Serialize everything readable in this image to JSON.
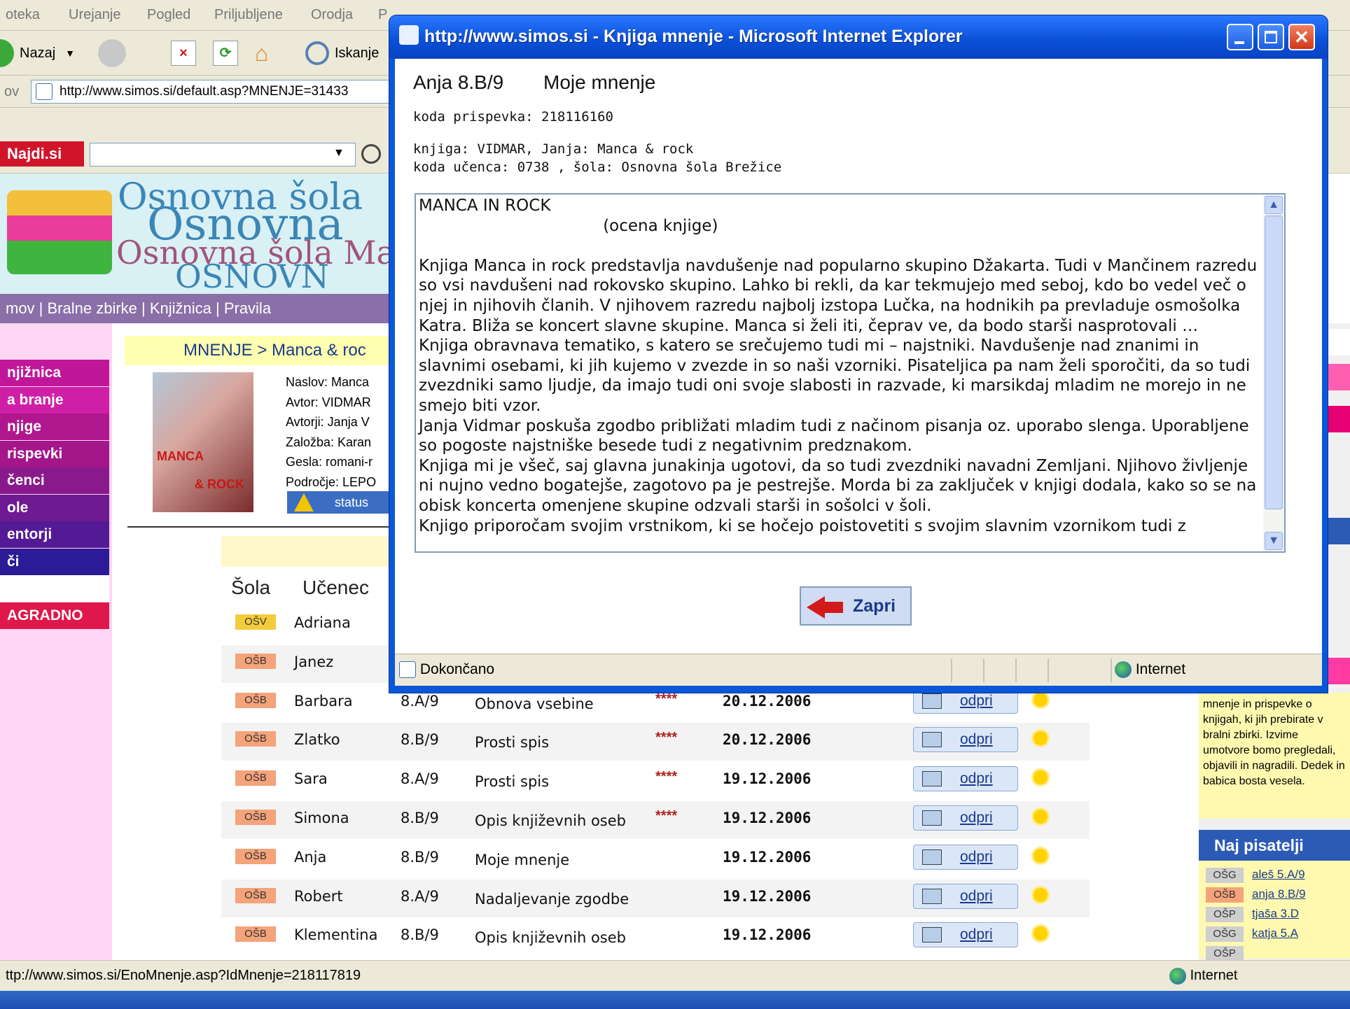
{
  "bg_menubar": [
    "oteka",
    "Urejanje",
    "Pogled",
    "Priljubljene",
    "Orodja",
    "P"
  ],
  "bg_toolbar": {
    "back_label": "Nazaj",
    "search_label": "Iskanje"
  },
  "bg_address": {
    "label": "ov",
    "url": "http://www.simos.si/default.asp?MNENJE=31433"
  },
  "najdi": {
    "logo": "Najdi.si"
  },
  "banner": {
    "line1": "Osnovna šola",
    "line2": "Osnovna",
    "line3": "Osnovna šola Maj",
    "line4": "OSNOVN"
  },
  "site_nav": "mov  |  Bralne zbirke  |  Knjižnica  |  Pravila",
  "side_menu": [
    {
      "label": "njižnica",
      "color": "#c0169a"
    },
    {
      "label": "a branje",
      "color": "#cf1fa7"
    },
    {
      "label": "njige",
      "color": "#b0168e"
    },
    {
      "label": "rispevki",
      "color": "#a4168a"
    },
    {
      "label": "čenci",
      "color": "#8a1a8c"
    },
    {
      "label": "ole",
      "color": "#6e1a92"
    },
    {
      "label": "entorji",
      "color": "#541a96"
    },
    {
      "label": "či",
      "color": "#2c1a96"
    },
    {
      "label": "",
      "color": "#ffffff"
    },
    {
      "label": "AGRADNO",
      "color": "#e0174a"
    }
  ],
  "crumb": "MNENJE > Manca & roc",
  "cover": {
    "t1": "MANCA",
    "t2": "& ROCK"
  },
  "book_meta": [
    "Naslov: Manca",
    "Avtor: VIDMAR",
    "Avtorji: Janja V",
    "Založba: Karan",
    "Gesla: romani-r",
    "Področje: LEPO"
  ],
  "status_label": "status",
  "table": {
    "headers": {
      "school": "Šola",
      "student": "Učenec"
    },
    "rows": [
      {
        "school": "OŠV",
        "student": "Adriana",
        "class": "",
        "type": "",
        "stars": "",
        "date": "",
        "open": ""
      },
      {
        "school": "OŠB",
        "student": "Janez",
        "class": "",
        "type": "",
        "stars": "",
        "date": "",
        "open": ""
      },
      {
        "school": "OŠB",
        "student": "Barbara",
        "class": "8.A/9",
        "type": "Obnova vsebine",
        "stars": "****",
        "date": "20.12.2006",
        "open": "odpri"
      },
      {
        "school": "OŠB",
        "student": "Zlatko",
        "class": "8.B/9",
        "type": "Prosti spis",
        "stars": "****",
        "date": "20.12.2006",
        "open": "odpri"
      },
      {
        "school": "OŠB",
        "student": "Sara",
        "class": "8.A/9",
        "type": "Prosti spis",
        "stars": "****",
        "date": "19.12.2006",
        "open": "odpri"
      },
      {
        "school": "OŠB",
        "student": "Simona",
        "class": "8.B/9",
        "type": "Opis književnih oseb",
        "stars": "****",
        "date": "19.12.2006",
        "open": "odpri"
      },
      {
        "school": "OŠB",
        "student": "Anja",
        "class": "8.B/9",
        "type": "Moje mnenje",
        "stars": "",
        "date": "19.12.2006",
        "open": "odpri"
      },
      {
        "school": "OŠB",
        "student": "Robert",
        "class": "8.A/9",
        "type": "Nadaljevanje zgodbe",
        "stars": "",
        "date": "19.12.2006",
        "open": "odpri"
      },
      {
        "school": "OŠB",
        "student": "Klementina",
        "class": "8.B/9",
        "type": "Opis književnih oseb",
        "stars": "",
        "date": "19.12.2006",
        "open": "odpri"
      }
    ]
  },
  "right_note": "mnenje in prispevke o knjigah, ki jih prebirate v bralni zbirki. Izvime umotvore bomo pregledali, objavili in nagradili. Dedek in babica bosta vesela.",
  "naj_pisatelji": {
    "title": "Naj pisatelji",
    "items": [
      {
        "school": "OŠG",
        "name": "aleš 5.A/9"
      },
      {
        "school": "OŠB",
        "name": "anja 8.B/9"
      },
      {
        "school": "OŠP",
        "name": "tjaša 3.D"
      },
      {
        "school": "OŠG",
        "name": "katja 5.A"
      },
      {
        "school": "OŠP",
        "name": ""
      }
    ]
  },
  "bg_status": {
    "url": "ttp://www.simos.si/EnoMnenje.asp?IdMnenje=218117819",
    "zone": "Internet"
  },
  "popup": {
    "title": "http://www.simos.si - Knjiga mnenje - Microsoft Internet Explorer",
    "name": "Anja  8.B/9",
    "heading": "Moje mnenje",
    "code_line": "koda prispevka: 218116160",
    "book_line": "knjiga: VIDMAR, Janja: Manca & rock",
    "student_line": "koda učenca: 0738 , šola: Osnovna šola Brežice",
    "text": "MANCA IN ROCK\n                                    (ocena knjige)\n\nKnjiga Manca in rock predstavlja navdušenje nad popularno skupino Džakarta. Tudi v Mančinem razredu so vsi navdušeni nad rokovsko skupino. Lahko bi rekli, da kar tekmujejo med seboj, kdo bo vedel več o njej in njihovih članih. V njihovem razredu najbolj izstopa Lučka, na hodnikih pa prevladuje osmošolka Katra. Bliža se koncert slavne skupine. Manca si želi iti, čeprav ve, da bodo starši nasprotovali …\nKnjiga obravnava tematiko, s katero se srečujemo tudi mi – najstniki. Navdušenje nad znanimi in slavnimi osebami, ki jih kujemo v zvezde in so naši vzorniki. Pisateljica pa nam želi sporočiti, da so tudi zvezdniki samo ljudje, da imajo tudi oni svoje slabosti in razvade, ki marsikdaj mladim ne morejo in ne smejo biti vzor.\nJanja Vidmar poskuša zgodbo približati mladim tudi z načinom pisanja oz. uporabo slenga. Uporabljene so pogoste najstniške besede tudi z negativnim predznakom.\nKnjiga mi je všeč, saj glavna junakinja ugotovi, da so tudi zvezdniki navadni Zemljani. Njihovo življenje ni nujno vedno bogatejše, zagotovo pa je pestrejše. Morda bi za zaključek v knjigi dodala, kako so se na obisk koncerta omenjene skupine odzvali starši in sošolci v šoli.\nKnjigo priporočam svojim vrstnikom, ki se hočejo poistovetiti s svojim slavnim vzornikom tudi z",
    "close_label": "Zapri",
    "status_text": "Dokončano",
    "zone": "Internet"
  }
}
